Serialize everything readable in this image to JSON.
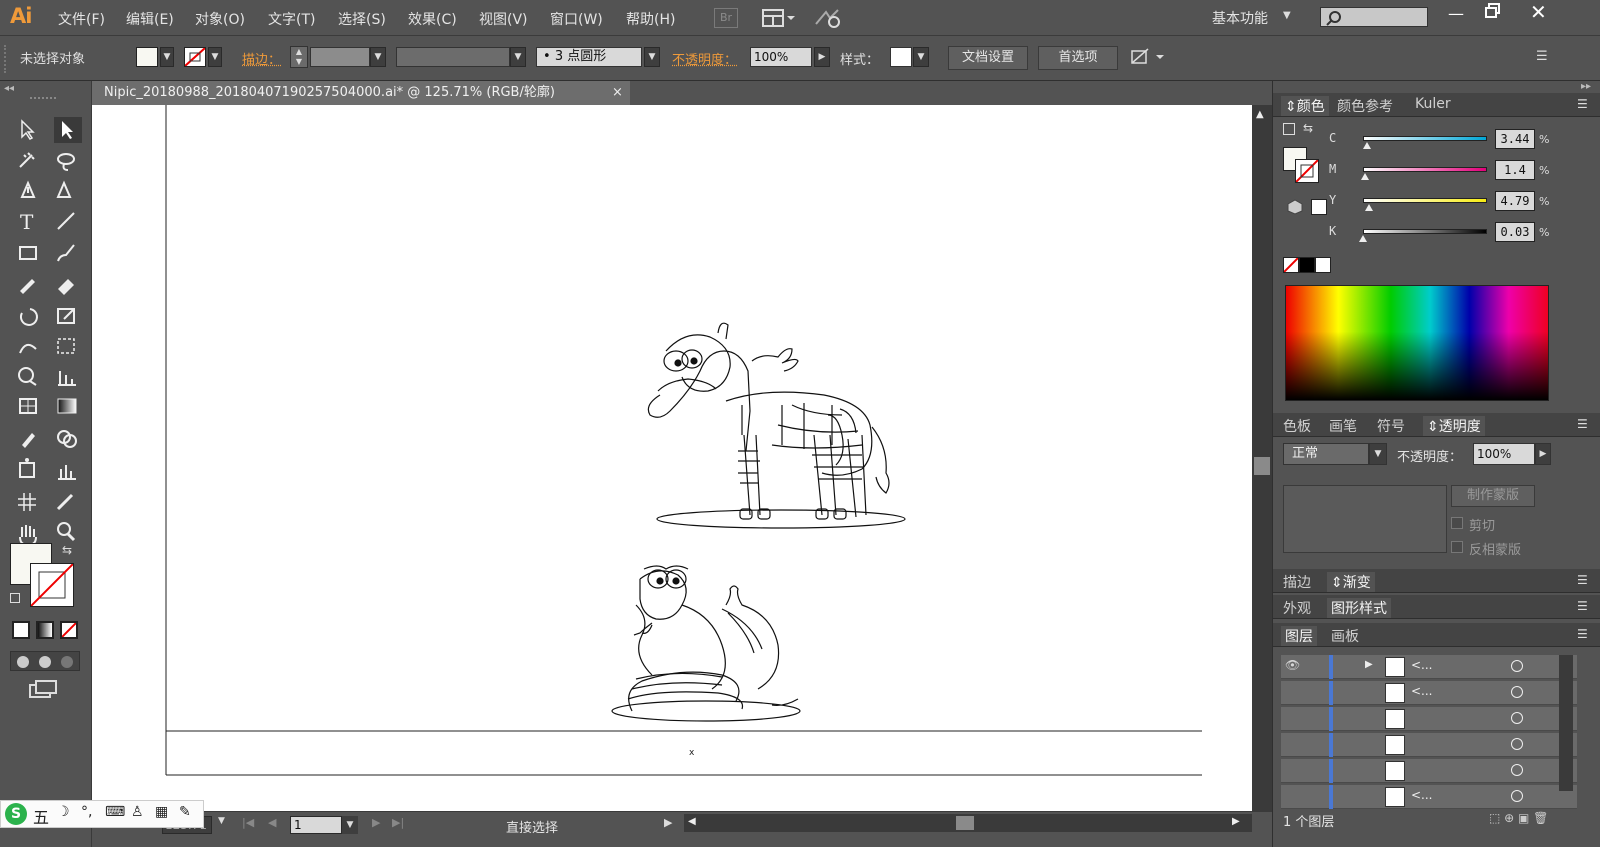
{
  "app": {
    "logo": "Ai"
  },
  "menu": {
    "items": [
      "文件(F)",
      "编辑(E)",
      "对象(O)",
      "文字(T)",
      "选择(S)",
      "效果(C)",
      "视图(V)",
      "窗口(W)",
      "帮助(H)"
    ],
    "bridge": "Br",
    "workspace": "基本功能"
  },
  "control": {
    "selection_state": "未选择对象",
    "stroke_label": "描边：",
    "brush_label": "3 点圆形",
    "opacity_label": "不透明度：",
    "opacity_value": "100%",
    "style_label": "样式：",
    "doc_settings": "文档设置",
    "preferences": "首选项"
  },
  "document": {
    "tab_title": "Nipic_20180988_20180407190257504000.ai* @ 125.71% (RGB/轮廓)",
    "close": "×"
  },
  "status": {
    "page_number": "1",
    "tool_name": "直接选择",
    "zoom_partial": "125.71"
  },
  "color_panel": {
    "tabs": [
      "颜色",
      "颜色参考",
      "Kuler"
    ],
    "channels": [
      {
        "label": "C",
        "value": "3.44",
        "color": "#00a6d6",
        "level": 0.0344
      },
      {
        "label": "M",
        "value": "1.4",
        "color": "#e2007a",
        "level": 0.014
      },
      {
        "label": "Y",
        "value": "4.79",
        "color": "#f7ec14",
        "level": 0.0479
      },
      {
        "label": "K",
        "value": "0.03",
        "color": "#000000",
        "level": 0.0003
      }
    ],
    "pct": "%"
  },
  "transparency_panel": {
    "tabs": [
      "色板",
      "画笔",
      "符号",
      "透明度"
    ],
    "blend_mode": "正常",
    "opacity_label": "不透明度：",
    "opacity_value": "100%",
    "make_mask": "制作蒙版",
    "clip": "剪切",
    "invert_mask": "反相蒙版"
  },
  "stroke_panel": {
    "tabs": [
      "描边",
      "渐变"
    ]
  },
  "appearance_panel": {
    "tabs": [
      "外观",
      "图形样式"
    ]
  },
  "layers_panel": {
    "tabs": [
      "图层",
      "画板"
    ],
    "rows": [
      "<...",
      "<...",
      "",
      "",
      "",
      "<..."
    ],
    "footer": "1 个图层"
  },
  "ime": {
    "label": "五"
  }
}
